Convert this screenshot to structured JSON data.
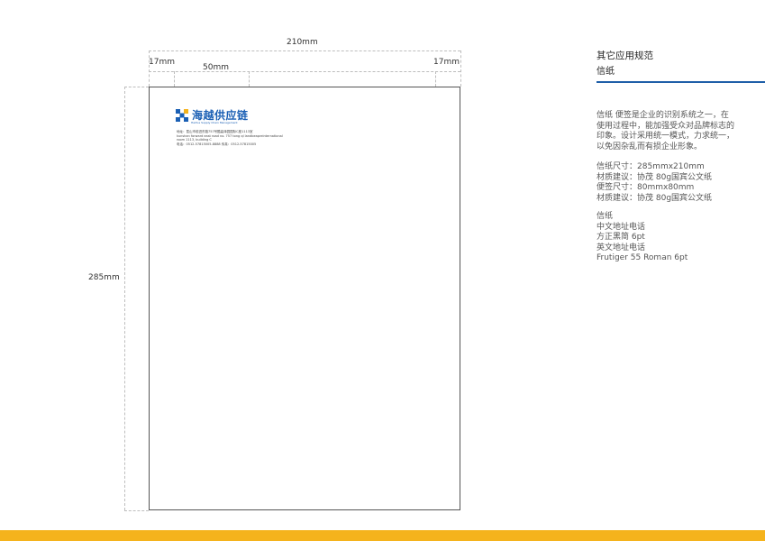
{
  "dimensions": {
    "width_label": "210mm",
    "left_margin_label": "17mm",
    "right_margin_label": "17mm",
    "offset_label": "50mm",
    "height_label": "285mm"
  },
  "letterhead": {
    "brand_name": "海越供应链",
    "brand_tagline": "HaiYue Supply Chain Management",
    "address_lines": [
      "地址：昆山市前进东路757号酷高泽园国际C座1113室",
      "kunshan forward east road no. 757 tong qi landbeapreinternational",
      "room 1113, building C",
      "电话：0512-57815005-8888   传真：0512-57815005"
    ]
  },
  "panel": {
    "title": "其它应用规范",
    "subtitle": "信纸",
    "description": [
      "信纸 便签是企业的识别系统之一，在",
      "使用过程中，能加强受众对品牌标志的",
      "印象。设计采用统一模式，力求统一，",
      "以免因杂乱而有损企业形象。"
    ],
    "specs": [
      "信纸尺寸：285mmx210mm",
      "材质建议：协茂 80g国宾公文纸",
      "便签尺寸：80mmx80mm",
      "材质建议：协茂 80g国宾公文纸"
    ],
    "fonts": [
      "信纸",
      "中文地址电话",
      "方正黑简      6pt",
      "英文地址电话",
      "Frutiger 55 Roman     6pt"
    ]
  },
  "colors": {
    "accent_blue": "#1f5fa8",
    "bottom_bar": "#f5b31c"
  }
}
